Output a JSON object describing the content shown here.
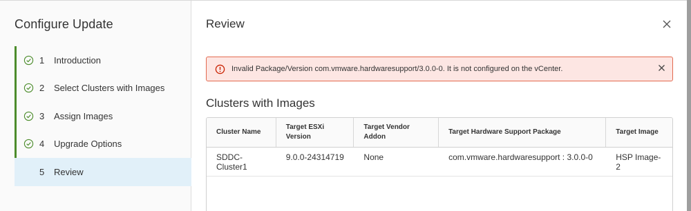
{
  "wizard": {
    "title": "Configure Update",
    "steps": [
      {
        "number": "1",
        "label": "Introduction",
        "completed": true
      },
      {
        "number": "2",
        "label": "Select Clusters with Images",
        "completed": true
      },
      {
        "number": "3",
        "label": "Assign Images",
        "completed": true
      },
      {
        "number": "4",
        "label": "Upgrade Options",
        "completed": true
      },
      {
        "number": "5",
        "label": "Review",
        "completed": false,
        "active": true
      }
    ]
  },
  "main": {
    "title": "Review",
    "alert": {
      "message": "Invalid Package/Version com.vmware.hardwaresupport/3.0.0-0. It is not configured on the vCenter."
    },
    "section_title": "Clusters with Images",
    "table": {
      "columns": [
        "Cluster Name",
        "Target ESXi Version",
        "Target Vendor Addon",
        "Target Hardware Support Package",
        "Target Image"
      ],
      "rows": [
        [
          "SDDC-Cluster1",
          "9.0.0-24314719",
          "None",
          "com.vmware.hardwaresupport : 3.0.0-0",
          "HSP Image-2"
        ]
      ]
    }
  },
  "colors": {
    "step_border": "#4c8c2b",
    "check_icon": "#4c8c2b",
    "active_step_bg": "#e1f0f9",
    "alert_bg": "#fde6e3",
    "alert_border": "#e3694f",
    "alert_icon": "#c92100"
  }
}
